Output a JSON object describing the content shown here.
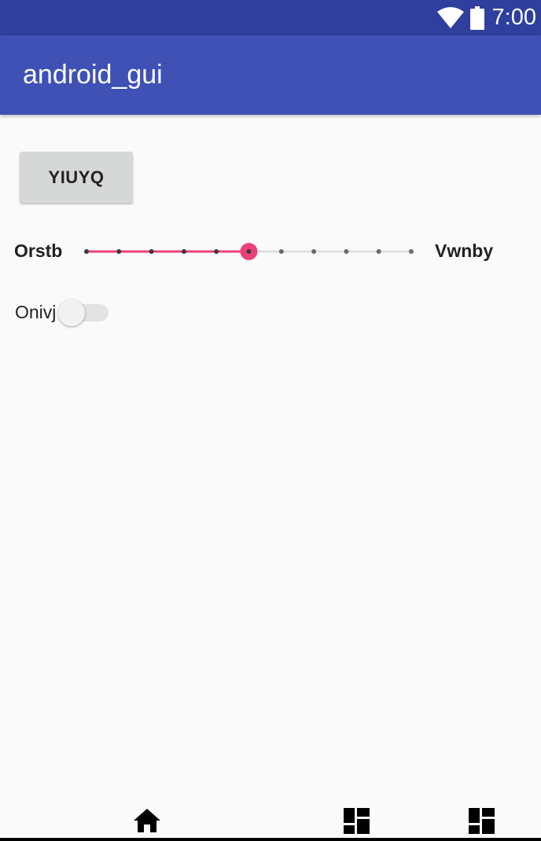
{
  "status_bar": {
    "time": "7:00",
    "icons": [
      "wifi-icon",
      "battery-icon"
    ]
  },
  "app_bar": {
    "title": "android_gui"
  },
  "main": {
    "button_label": "YIUYQ",
    "slider": {
      "left_label": "Orstb",
      "right_label": "Vwnby",
      "steps": 10,
      "value": 5,
      "active_color": "#ec407a",
      "inactive_color": "#e0e0e0"
    },
    "switch": {
      "label": "Onivj",
      "checked": false
    }
  },
  "nav_bar": {
    "icons": [
      "home-icon",
      "dashboard-icon",
      "dashboard-icon"
    ]
  },
  "colors": {
    "status_bar": "#2f3f9e",
    "app_bar": "#3f51b5",
    "background": "#fafafa",
    "accent": "#ec407a"
  }
}
